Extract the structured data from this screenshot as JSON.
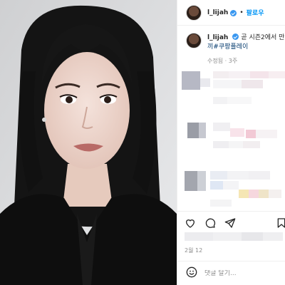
{
  "post": {
    "username": "l_lijah",
    "dot": "•",
    "follow_label": "팔로우",
    "caption_username": "l_lijah",
    "caption_text_line1": "곧 시즌2에서 만",
    "caption_hashtag": "끼#쿠팡플레이",
    "edited_label": "수정됨",
    "age": "· 3주",
    "date": "2월 12",
    "comment_placeholder": "댓글 달기..."
  },
  "photo": {
    "description_icon": "photo-of-person"
  },
  "actions": {
    "like_icon": "heart-icon",
    "comment_icon": "comment-icon",
    "share_icon": "share-icon",
    "save_icon": "bookmark-icon"
  },
  "colors": {
    "accent": "#0095f6",
    "verified": "#3897f0",
    "muted": "#8e8e8e"
  }
}
